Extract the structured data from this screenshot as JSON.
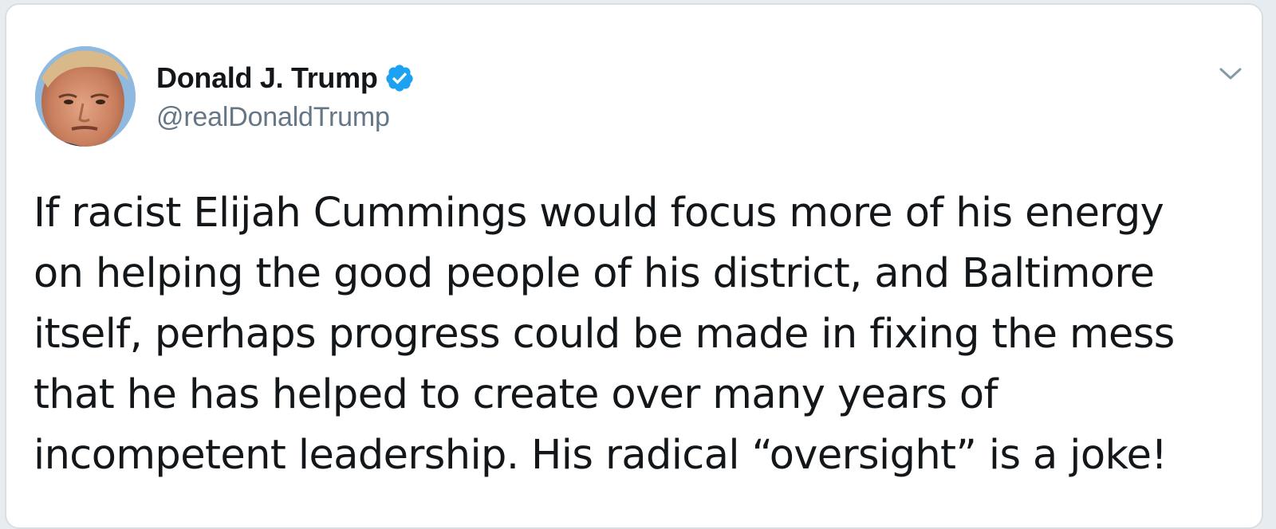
{
  "tweet": {
    "author": {
      "display_name": "Donald J. Trump",
      "handle": "@realDonaldTrump",
      "verified": true,
      "avatar_icon": "profile-photo"
    },
    "menu_icon": "chevron-down-icon",
    "text": "If racist Elijah Cummings would focus more of his energy\non helping the good people of his district, and Baltimore\nitself, perhaps progress could be made in fixing the mess\nthat he has helped to create over many years of\nincompetent leadership. His radical “oversight” is a joke!"
  },
  "colors": {
    "text_primary": "#14171a",
    "text_secondary": "#657786",
    "verified_blue": "#1da1f2",
    "card_border": "#d9dee3"
  }
}
